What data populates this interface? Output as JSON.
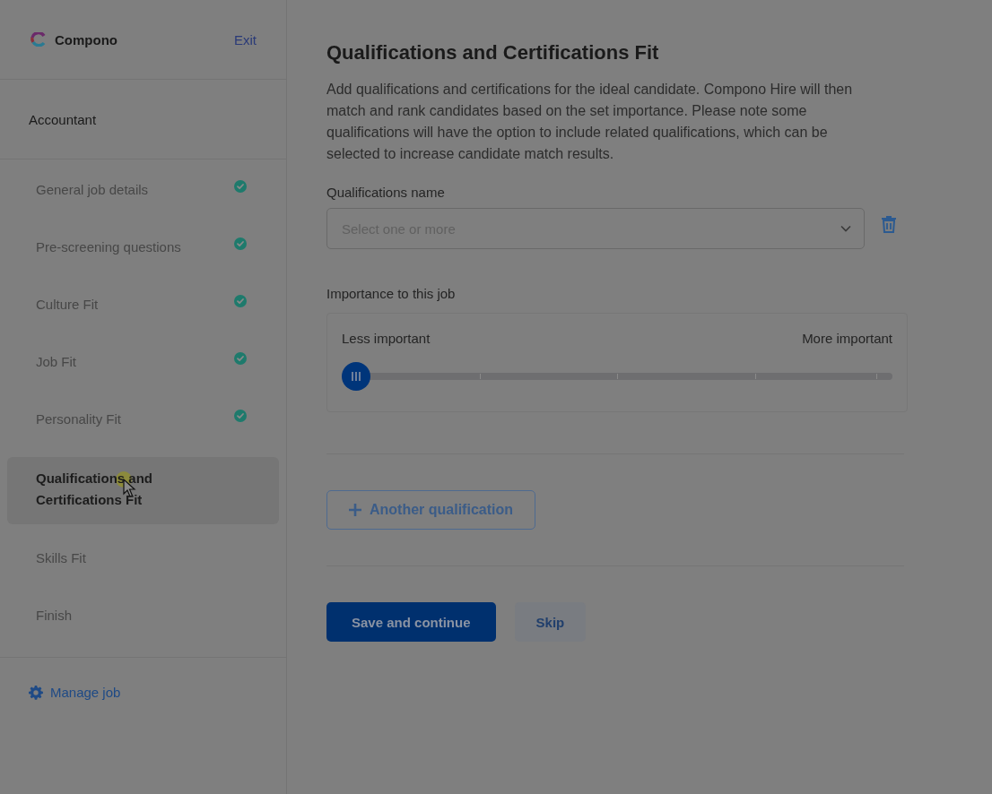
{
  "brand": {
    "name": "Compono",
    "exit": "Exit"
  },
  "job_title": "Accountant",
  "steps": [
    {
      "label": "General job details",
      "completed": true,
      "selected": false
    },
    {
      "label": "Pre-screening questions",
      "completed": true,
      "selected": false
    },
    {
      "label": "Culture Fit",
      "completed": true,
      "selected": false
    },
    {
      "label": "Job Fit",
      "completed": true,
      "selected": false
    },
    {
      "label": "Personality Fit",
      "completed": true,
      "selected": false
    },
    {
      "label": "Qualifications and Certifications Fit",
      "completed": false,
      "selected": true
    },
    {
      "label": "Skills Fit",
      "completed": false,
      "selected": false
    },
    {
      "label": "Finish",
      "completed": false,
      "selected": false
    }
  ],
  "manage_job": "Manage job",
  "page": {
    "title": "Qualifications and Certifications Fit",
    "description": "Add qualifications and certifications for the ideal candidate. Compono Hire will then match and rank candidates based on the set importance. Please note some qualifications will have the option to include related qualifications, which can be selected to increase candidate match results."
  },
  "qualification": {
    "label": "Qualifications name",
    "placeholder": "Select one or more"
  },
  "importance": {
    "label": "Importance to this job",
    "min_label": "Less important",
    "max_label": "More important",
    "level": 0
  },
  "add_button": "Another qualification",
  "buttons": [
    {
      "label": "Save and continue",
      "kind": "primary"
    },
    {
      "label": "Skip",
      "kind": "secondary"
    }
  ]
}
